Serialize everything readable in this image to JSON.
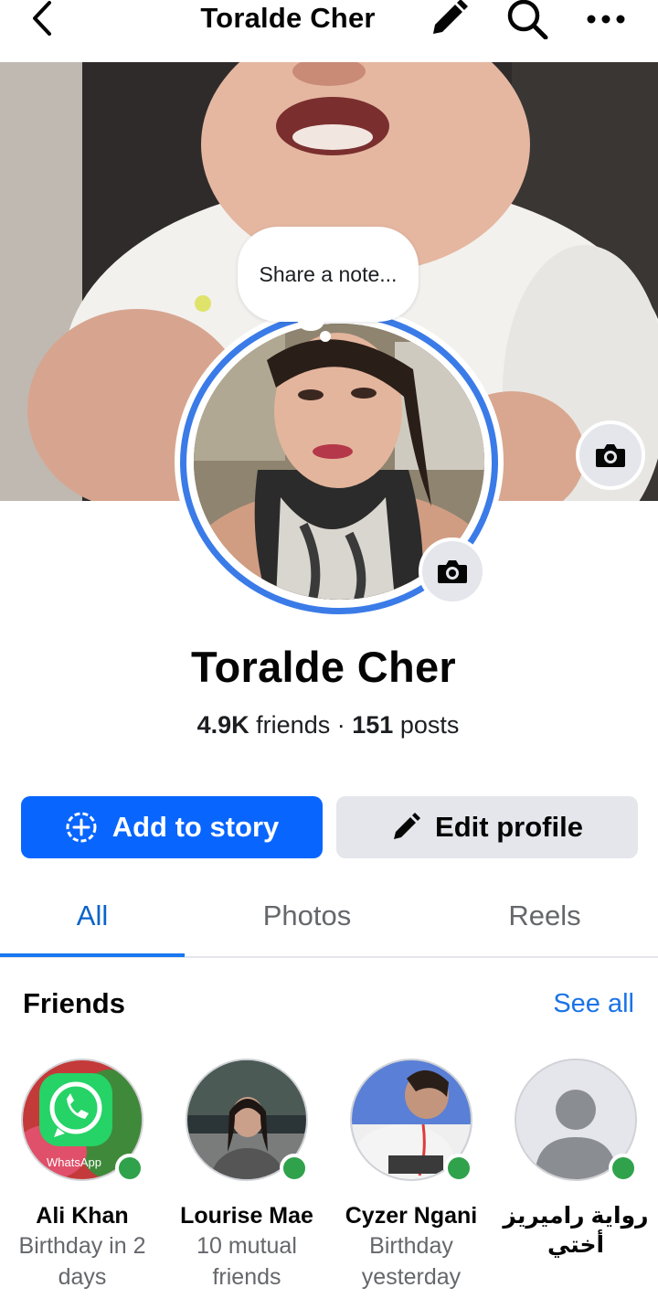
{
  "header": {
    "title": "Toralde Cher",
    "icons": [
      "back-arrow-icon",
      "pencil-icon",
      "search-icon",
      "more-icon"
    ]
  },
  "note": {
    "placeholder": "Share a note..."
  },
  "profile": {
    "name": "Toralde Cher",
    "friends_count": "4.9K",
    "friends_label": "friends",
    "separator": "·",
    "posts_count": "151",
    "posts_label": "posts"
  },
  "actions": {
    "add_story": "Add to story",
    "edit_profile": "Edit profile"
  },
  "tabs": [
    {
      "label": "All",
      "active": true
    },
    {
      "label": "Photos",
      "active": false
    },
    {
      "label": "Reels",
      "active": false
    }
  ],
  "friends": {
    "title": "Friends",
    "see_all": "See all",
    "items": [
      {
        "name": "Ali Khan",
        "subtitle": "Birthday in 2 days",
        "avatar_text": "WhatsApp",
        "online": true
      },
      {
        "name": "Lourise Mae",
        "subtitle": "10 mutual friends",
        "online": true
      },
      {
        "name": "Cyzer Ngani",
        "subtitle": "Birthday yesterday",
        "online": true
      },
      {
        "name": "رواية راميريز أختي",
        "subtitle": "",
        "online": true
      }
    ]
  },
  "colors": {
    "primary_blue": "#0866ff",
    "link_blue": "#1a73e8",
    "tab_active": "#0a64c8",
    "button_gray": "#e4e6eb",
    "online_green": "#31a24c",
    "story_ring": "#3b7be8"
  }
}
